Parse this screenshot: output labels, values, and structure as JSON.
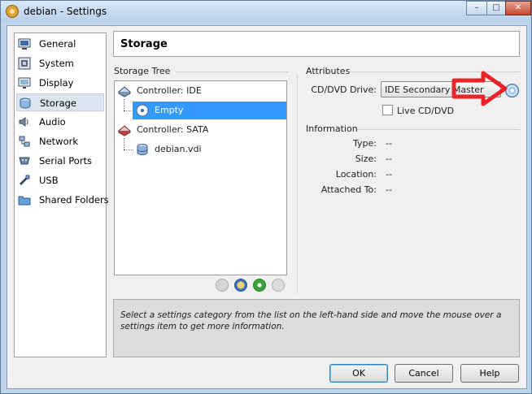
{
  "window": {
    "title": "debian - Settings"
  },
  "window_controls": {
    "minimize": "–",
    "maximize": "□",
    "close": "✕"
  },
  "sidebar": {
    "items": [
      {
        "label": "General",
        "icon": "general-icon"
      },
      {
        "label": "System",
        "icon": "system-icon"
      },
      {
        "label": "Display",
        "icon": "display-icon"
      },
      {
        "label": "Storage",
        "icon": "storage-icon",
        "selected": true
      },
      {
        "label": "Audio",
        "icon": "audio-icon"
      },
      {
        "label": "Network",
        "icon": "network-icon"
      },
      {
        "label": "Serial Ports",
        "icon": "serial-ports-icon"
      },
      {
        "label": "USB",
        "icon": "usb-icon"
      },
      {
        "label": "Shared Folders",
        "icon": "shared-folders-icon"
      }
    ]
  },
  "header": {
    "title": "Storage"
  },
  "storage_tree": {
    "title": "Storage Tree",
    "items": [
      {
        "label": "Controller: IDE",
        "icon": "ide-controller-icon"
      },
      {
        "label": "Empty",
        "icon": "cd-disc-icon",
        "selected": true
      },
      {
        "label": "Controller: SATA",
        "icon": "sata-controller-icon"
      },
      {
        "label": "debian.vdi",
        "icon": "hard-disk-icon"
      }
    ]
  },
  "attributes": {
    "title": "Attributes",
    "cd_dvd_label": "CD/DVD Drive:",
    "cd_dvd_value": "IDE Secondary Master",
    "live_cd_label": "Live CD/DVD",
    "live_cd_checked": false
  },
  "information": {
    "title": "Information",
    "rows": [
      {
        "label": "Type:",
        "value": "--"
      },
      {
        "label": "Size:",
        "value": "--"
      },
      {
        "label": "Location:",
        "value": "--"
      },
      {
        "label": "Attached To:",
        "value": "--"
      }
    ]
  },
  "help_text": "Select a settings category from the list on the left-hand side and move the mouse over a settings item to get more information.",
  "buttons": {
    "ok": "OK",
    "cancel": "Cancel",
    "help": "Help"
  },
  "colors": {
    "selection": "#3399ff",
    "annotation_arrow": "#e8232a"
  }
}
